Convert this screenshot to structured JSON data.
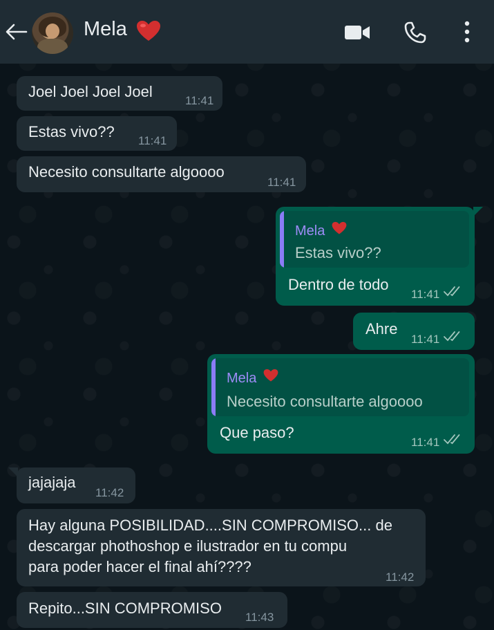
{
  "header": {
    "contact_name": "Mela",
    "contact_emoji": "heart-emoji",
    "back_icon": "back-arrow-icon",
    "video_icon": "video-call-icon",
    "call_icon": "phone-icon",
    "menu_icon": "more-options-icon"
  },
  "messages": [
    {
      "direction": "incoming",
      "text": "Joel Joel Joel Joel",
      "time": "11:41"
    },
    {
      "direction": "incoming",
      "text": "Estas vivo??",
      "time": "11:41"
    },
    {
      "direction": "incoming",
      "text": "Necesito consultarte algoooo",
      "time": "11:41"
    },
    {
      "direction": "outgoing",
      "quote_author": "Mela",
      "quote_text": "Estas vivo??",
      "text": "Dentro de todo",
      "time": "11:41",
      "status": "read"
    },
    {
      "direction": "outgoing",
      "text": "Ahre",
      "time": "11:41",
      "status": "read"
    },
    {
      "direction": "outgoing",
      "quote_author": "Mela",
      "quote_text": "Necesito consultarte algoooo",
      "text": "Que paso?",
      "time": "11:41",
      "status": "read"
    },
    {
      "direction": "incoming",
      "text": "jajajaja",
      "time": "11:42"
    },
    {
      "direction": "incoming",
      "lines": [
        "Hay alguna POSIBILIDAD....SIN COMPROMISO... de",
        "descargar phothoshop e ilustrador en tu compu",
        "para poder hacer el final ahí????"
      ],
      "time": "11:42"
    },
    {
      "direction": "incoming",
      "text": "Repito...SIN COMPROMISO",
      "time": "11:43"
    }
  ],
  "colors": {
    "background": "#0b141a",
    "header": "#1f2c34",
    "incoming_bubble": "#202c33",
    "outgoing_bubble": "#005c4b",
    "quote_author": "#9d8cf7",
    "heart": "#d32f2f"
  }
}
